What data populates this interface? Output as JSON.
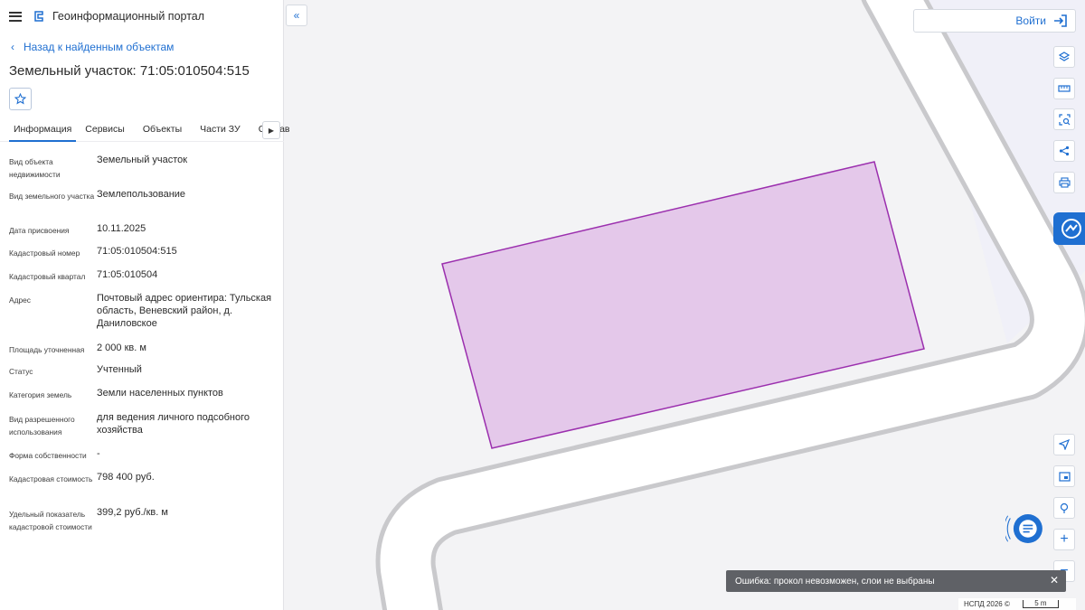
{
  "header": {
    "app_title": "Геоинформационный портал"
  },
  "nav": {
    "back_label": "Назад к найденным объектам"
  },
  "object": {
    "title": "Земельный участок: 71:05:010504:515"
  },
  "tabs": [
    {
      "label": "Информация"
    },
    {
      "label": "Сервисы"
    },
    {
      "label": "Объекты"
    },
    {
      "label": "Части ЗУ"
    },
    {
      "label": "Состав"
    }
  ],
  "properties": [
    {
      "label": "Вид объекта недвижимости",
      "value": "Земельный участок"
    },
    {
      "label": "Вид земельного участка",
      "value": "Землепользование"
    },
    {
      "label": "Дата присвоения",
      "value": "10.11.2025"
    },
    {
      "label": "Кадастровый номер",
      "value": "71:05:010504:515"
    },
    {
      "label": "Кадастровый квартал",
      "value": "71:05:010504"
    },
    {
      "label": "Адрес",
      "value": "Почтовый адрес ориентира: Тульская область, Веневский район, д. Даниловское"
    },
    {
      "label": "Площадь уточненная",
      "value": "2 000 кв. м"
    },
    {
      "label": "Статус",
      "value": "Учтенный"
    },
    {
      "label": "Категория земель",
      "value": "Земли населенных пунктов"
    },
    {
      "label": "Вид разрешенного использования",
      "value": "для ведения личного подсобного хозяйства"
    },
    {
      "label": "Форма собственности",
      "value": "-"
    },
    {
      "label": "Кадастровая стоимость",
      "value": "798 400 руб."
    },
    {
      "label": "Удельный показатель кадастровой стоимости",
      "value": "399,2 руб./кв. м"
    }
  ],
  "map": {
    "login_label": "Войти",
    "error_message": "Ошибка: прокол невозможен, слои не выбраны",
    "copyright": "НСПД 2026 ©",
    "scale_label": "5 m",
    "parcel_fill": "#e4c8ea",
    "parcel_stroke": "#9b2fae",
    "accent": "#1f6fd1"
  }
}
